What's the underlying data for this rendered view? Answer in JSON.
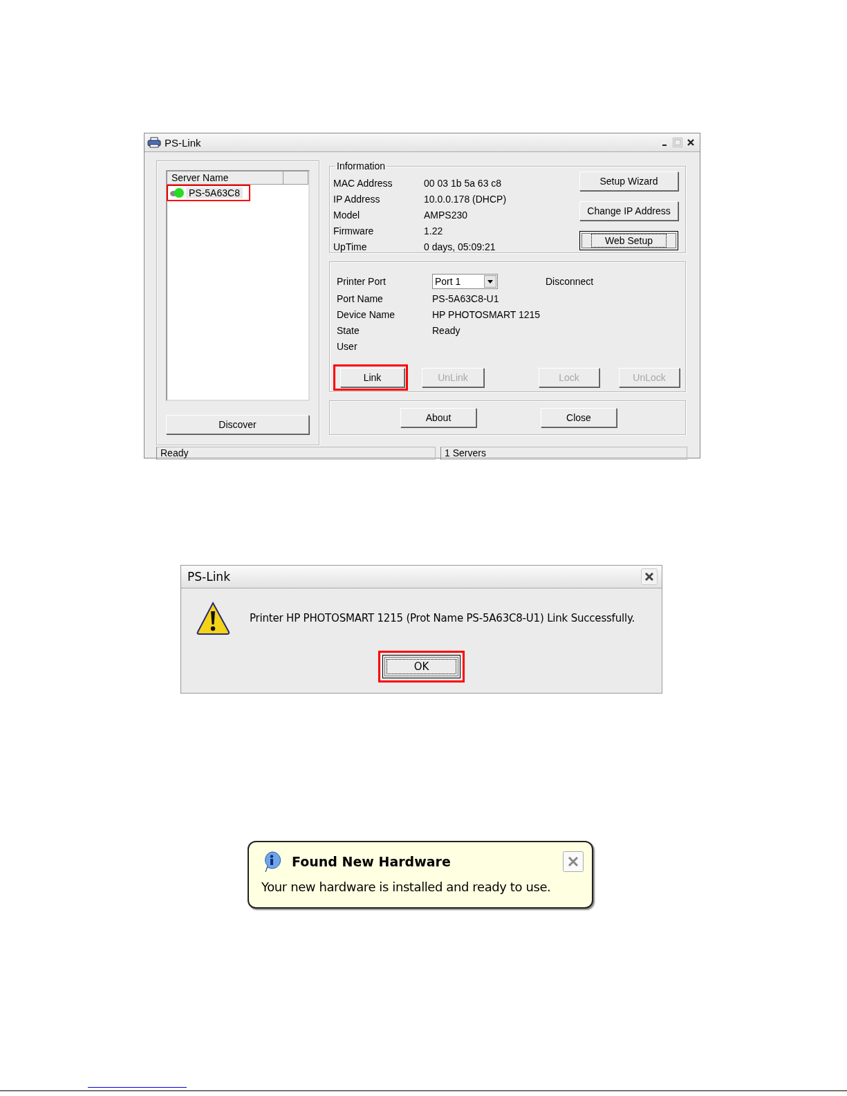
{
  "main_window": {
    "title": "PS-Link",
    "server_list": {
      "column_header": "Server Name",
      "items": [
        {
          "name": "PS-5A63C8",
          "color": "#22dd22",
          "selected": true,
          "highlighted": true
        }
      ]
    },
    "discover_button": {
      "label": "Discover",
      "disabled": false,
      "highlighted": false,
      "focused": false
    },
    "information": {
      "legend": "Information",
      "fields": [
        {
          "label": "MAC Address",
          "value": "00 03 1b 5a 63 c8"
        },
        {
          "label": "IP Address",
          "value": "10.0.0.178 (DHCP)"
        },
        {
          "label": "Model",
          "value": "AMPS230"
        },
        {
          "label": "Firmware",
          "value": "1.22"
        },
        {
          "label": "UpTime",
          "value": "0 days, 05:09:21"
        }
      ],
      "buttons": [
        {
          "label": "Setup Wizard",
          "disabled": false,
          "highlighted": false,
          "focused": false
        },
        {
          "label": "Change IP Address",
          "disabled": false,
          "highlighted": false,
          "focused": false
        },
        {
          "label": "Web Setup",
          "disabled": false,
          "highlighted": false,
          "focused": true
        }
      ]
    },
    "printer": {
      "connection_status": "Disconnect",
      "fields": [
        {
          "label": "Printer Port",
          "value": "Port 1",
          "kind": "dropdown"
        },
        {
          "label": "Port Name",
          "value": "PS-5A63C8-U1",
          "kind": "text"
        },
        {
          "label": "Device Name",
          "value": "HP PHOTOSMART 1215",
          "kind": "text"
        },
        {
          "label": "State",
          "value": "Ready",
          "kind": "text"
        },
        {
          "label": "User",
          "kind": "text"
        }
      ],
      "buttons": [
        {
          "label": "Link",
          "disabled": false,
          "highlighted": true,
          "focused": false
        },
        {
          "label": "UnLink",
          "disabled": true,
          "highlighted": false,
          "focused": false
        },
        {
          "label": "Lock",
          "disabled": true,
          "highlighted": false,
          "focused": false
        },
        {
          "label": "UnLock",
          "disabled": true,
          "highlighted": false,
          "focused": false
        }
      ]
    },
    "footer_buttons": [
      {
        "label": "About",
        "disabled": false,
        "highlighted": false,
        "focused": false
      },
      {
        "label": "Close",
        "disabled": false,
        "highlighted": false,
        "focused": false
      }
    ],
    "status_bar": [
      "Ready",
      "1 Servers"
    ]
  },
  "message_dialog": {
    "title": "PS-Link",
    "message": "Printer HP PHOTOSMART 1215 (Prot Name PS-5A63C8-U1) Link Successfully.",
    "button": {
      "label": "OK",
      "disabled": false,
      "highlighted": true,
      "focused": true
    }
  },
  "notification_balloon": {
    "title": "Found New Hardware",
    "message": "Your new hardware is installed and ready to use."
  }
}
